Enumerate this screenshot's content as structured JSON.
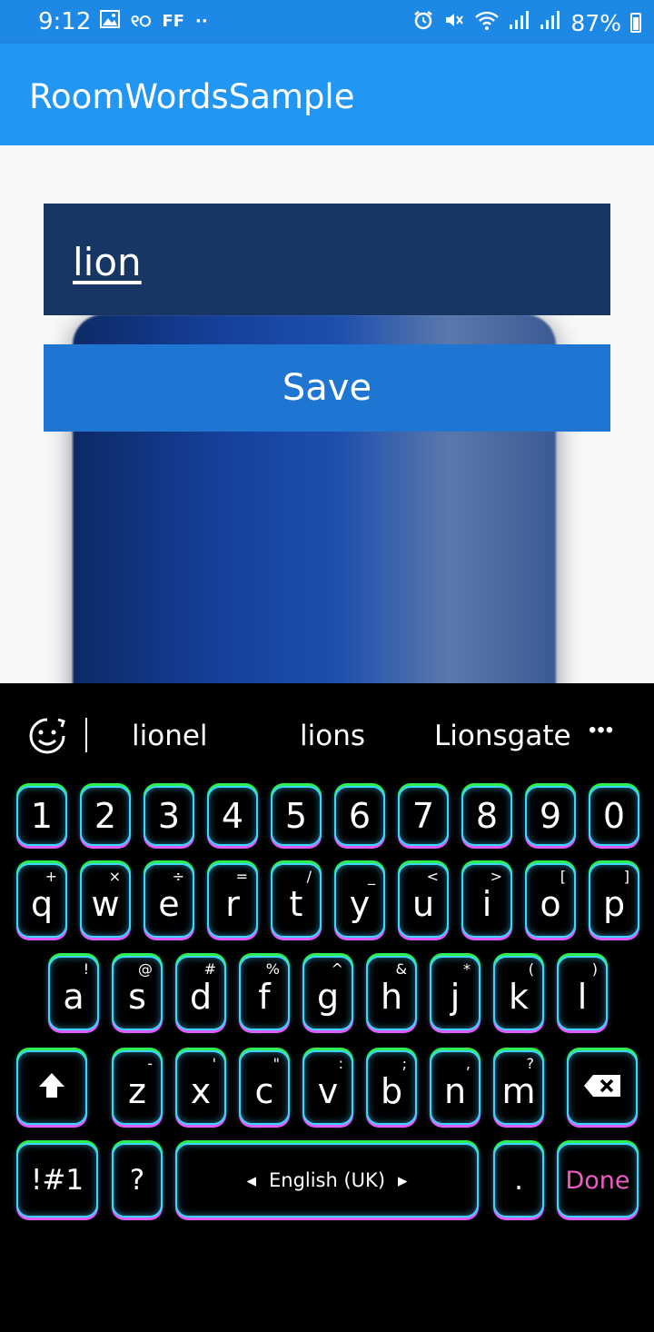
{
  "status_bar": {
    "time": "9:12",
    "notif_text_1": "୧୦",
    "notif_text_2": "FF",
    "notif_dots": "··",
    "battery": "87%"
  },
  "app": {
    "title": "RoomWordsSample"
  },
  "form": {
    "word_value": "lion",
    "save_label": "Save"
  },
  "keyboard": {
    "suggestions": [
      "lionel",
      "lions",
      "Lionsgate"
    ],
    "more": "•••",
    "numbers": [
      "1",
      "2",
      "3",
      "4",
      "5",
      "6",
      "7",
      "8",
      "9",
      "0"
    ],
    "row1": [
      {
        "k": "q",
        "s": "+"
      },
      {
        "k": "w",
        "s": "×"
      },
      {
        "k": "e",
        "s": "÷"
      },
      {
        "k": "r",
        "s": "="
      },
      {
        "k": "t",
        "s": "/"
      },
      {
        "k": "y",
        "s": "_"
      },
      {
        "k": "u",
        "s": "<"
      },
      {
        "k": "i",
        "s": ">"
      },
      {
        "k": "o",
        "s": "["
      },
      {
        "k": "p",
        "s": "]"
      }
    ],
    "row2": [
      {
        "k": "a",
        "s": "!"
      },
      {
        "k": "s",
        "s": "@"
      },
      {
        "k": "d",
        "s": "#"
      },
      {
        "k": "f",
        "s": "%"
      },
      {
        "k": "g",
        "s": "^"
      },
      {
        "k": "h",
        "s": "&"
      },
      {
        "k": "j",
        "s": "*"
      },
      {
        "k": "k",
        "s": "("
      },
      {
        "k": "l",
        "s": ")"
      }
    ],
    "row3": [
      {
        "k": "z",
        "s": "-"
      },
      {
        "k": "x",
        "s": "'"
      },
      {
        "k": "c",
        "s": "\""
      },
      {
        "k": "v",
        "s": ":"
      },
      {
        "k": "b",
        "s": ";"
      },
      {
        "k": "n",
        "s": ","
      },
      {
        "k": "m",
        "s": "?"
      }
    ],
    "symbols_label": "!#1",
    "question_label": "?",
    "space_label": "English (UK)",
    "period_label": ".",
    "done_label": "Done",
    "colors": {
      "glow_top": "#2df04e",
      "glow_side": "#3bd6ff",
      "glow_bottom": "#e05cff",
      "done": "#ee5cc3"
    }
  }
}
